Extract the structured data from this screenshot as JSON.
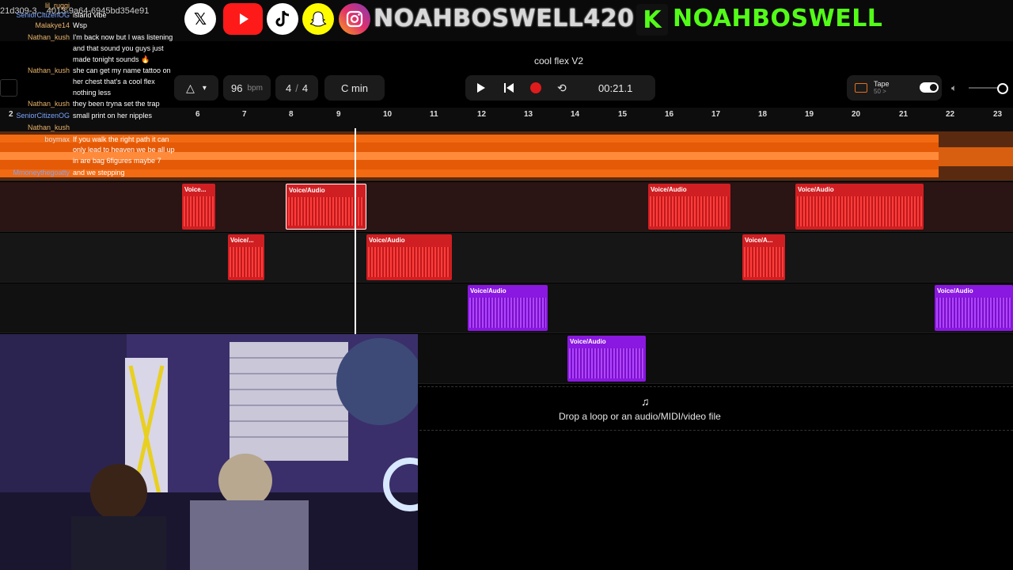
{
  "overlay": {
    "id_fragment": "21d309-3... 4013-9a64-6945bd354e91",
    "handles": {
      "socials_handle": "NOAHBOSWELL420",
      "kick_handle": "NOAHBOSWELL"
    },
    "kick_logo": "K",
    "icons": [
      "x-icon",
      "youtube-icon",
      "tiktok-icon",
      "snapchat-icon",
      "instagram-icon"
    ]
  },
  "chat": [
    {
      "name": "lil_ruggi",
      "msg": ""
    },
    {
      "name": "SeniorCitizenOG",
      "msg": "island vibe"
    },
    {
      "name": "Malakye14",
      "msg": "Wsp"
    },
    {
      "name": "Nathan_kush",
      "msg": "I'm back now but I was listening"
    },
    {
      "name": "",
      "msg": "and that sound you guys just"
    },
    {
      "name": "",
      "msg": "made tonight sounds 🔥"
    },
    {
      "name": "Nathan_kush",
      "msg": "she can get my name tattoo on"
    },
    {
      "name": "",
      "msg": "her chest that's a cool flex"
    },
    {
      "name": "",
      "msg": "nothing less"
    },
    {
      "name": "Nathan_kush",
      "msg": "they been tryna set the trap"
    },
    {
      "name": "SeniorCitizenOG",
      "msg": "small print on her nipples"
    },
    {
      "name": "Nathan_kush",
      "msg": ""
    },
    {
      "name": "boymax",
      "msg": "If you walk the right path it can"
    },
    {
      "name": "",
      "msg": "only lead to heaven we be all up"
    },
    {
      "name": "",
      "msg": "in are bag 6figures maybe 7"
    },
    {
      "name": "Mmoneythegoatty",
      "msg": "and we stepping"
    }
  ],
  "daw": {
    "project_title": "cool flex V2",
    "bpm": "96",
    "bpm_unit": "bpm",
    "time_sig_num": "4",
    "time_sig_sep": "/",
    "time_sig_den": "4",
    "key": "C min",
    "time": "00:21.1",
    "tape_label": "Tape",
    "tape_sub": "50 >",
    "drop_text": "Drop a loop or an audio/MIDI/video file",
    "ruler": [
      "2",
      "6",
      "7",
      "8",
      "9",
      "10",
      "11",
      "12",
      "13",
      "14",
      "15",
      "16",
      "17",
      "18",
      "19",
      "20",
      "21",
      "22",
      "23"
    ],
    "clip_label": "Voice/Audio",
    "clip_label_short": "Voice/...",
    "clip_label_short2": "Voice/A...",
    "clip_label_short3": "Voice..."
  },
  "colors": {
    "orange": "#f26a12",
    "red": "#e3262a",
    "purple": "#9b1bf0",
    "accent_record": "#e01b1b"
  }
}
